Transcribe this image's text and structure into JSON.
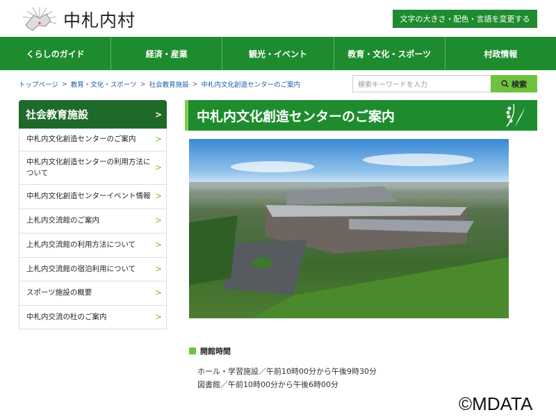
{
  "header": {
    "site_name": "中札内村",
    "lang_button": "文字の大きさ・配色・言語を変更する"
  },
  "nav": [
    "くらしのガイド",
    "経済・産業",
    "観光・イベント",
    "教育・文化・スポーツ",
    "村政情報"
  ],
  "breadcrumb": [
    "トップページ",
    "教育・文化・スポーツ",
    "社会教育施設",
    "中札内文化創造センターのご案内"
  ],
  "search": {
    "placeholder": "検索キーワードを入力",
    "button": "検索"
  },
  "sidebar": {
    "title": "社会教育施設",
    "items": [
      "中札内文化創造センターのご案内",
      "中札内文化創造センターの利用方法について",
      "中札内文化創造センターイベント情報",
      "上札内交流館のご案内",
      "上札内交流館の利用方法について",
      "上札内交流館の宿泊利用について",
      "スポーツ施設の概要",
      "中札内交流の杜のご案内"
    ]
  },
  "main": {
    "title": "中札内文化創造センターのご案内",
    "hours_heading": "開館時間",
    "hours": [
      "ホール・学習施設／午前10時00分から午後9時30分",
      "図書館／午前10時00分から午後6時00分"
    ]
  },
  "watermark": "©MDATA",
  "colors": {
    "brand_green": "#1e8c2e",
    "accent_green": "#6fc23d",
    "sidebar_head": "#1f6a2a"
  }
}
